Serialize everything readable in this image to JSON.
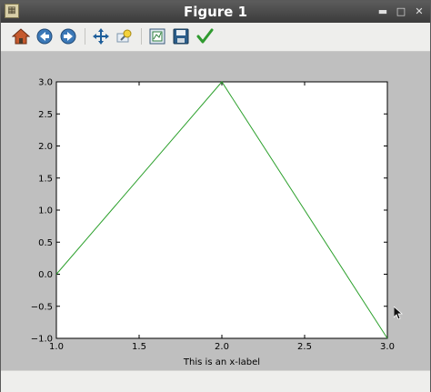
{
  "window": {
    "title": "Figure 1"
  },
  "toolbar": {
    "items": [
      {
        "name": "home-icon"
      },
      {
        "name": "back-icon"
      },
      {
        "name": "forward-icon"
      },
      {
        "name": "pan-icon"
      },
      {
        "name": "zoom-icon"
      },
      {
        "name": "subplots-icon"
      },
      {
        "name": "save-icon"
      },
      {
        "name": "edit-axis-icon"
      }
    ]
  },
  "colors": {
    "line": "#2ca02c",
    "canvas": "#bfbfbf",
    "axes_bg": "#ffffff"
  },
  "chart_data": {
    "type": "line",
    "title": "",
    "xlabel": "This is an x-label",
    "ylabel": "",
    "xlim": [
      1.0,
      3.0
    ],
    "ylim": [
      -1.0,
      3.0
    ],
    "xticks": [
      "1.0",
      "1.5",
      "2.0",
      "2.5",
      "3.0"
    ],
    "yticks": [
      "−1.0",
      "−0.5",
      "0.0",
      "0.5",
      "1.0",
      "1.5",
      "2.0",
      "2.5",
      "3.0"
    ],
    "series": [
      {
        "x": [
          1.0,
          2.0,
          3.0
        ],
        "y": [
          0.0,
          3.0,
          -1.0
        ],
        "color": "#2ca02c"
      }
    ],
    "grid": false,
    "legend": "none"
  }
}
